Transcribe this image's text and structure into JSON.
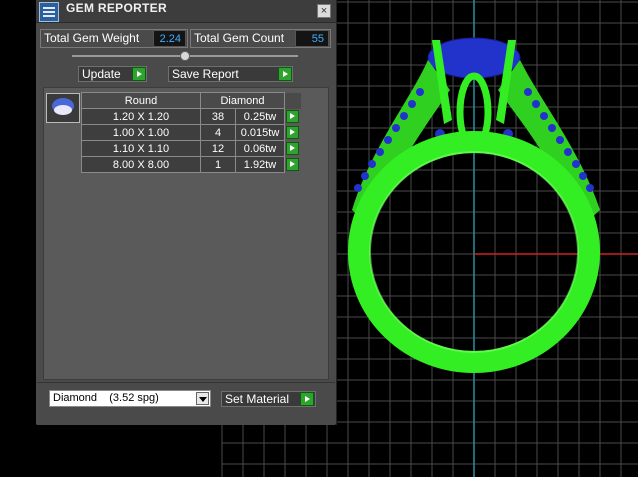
{
  "window": {
    "title": "GEM REPORTER",
    "close_label": "×"
  },
  "summary": {
    "total_weight_label": "Total Gem Weight",
    "total_weight_value": "2.24",
    "total_count_label": "Total Gem Count",
    "total_count_value": "55"
  },
  "toolbar": {
    "update_label": "Update",
    "save_report_label": "Save Report"
  },
  "gem_table": {
    "shape_header": "Round",
    "material_header": "Diamond",
    "rows": [
      {
        "size": "1.20 X 1.20",
        "count": "38",
        "weight": "0.25tw"
      },
      {
        "size": "1.00 X 1.00",
        "count": "4",
        "weight": "0.015tw"
      },
      {
        "size": "1.10 X 1.10",
        "count": "12",
        "weight": "0.06tw"
      },
      {
        "size": "8.00 X 8.00",
        "count": "1",
        "weight": "1.92tw"
      }
    ]
  },
  "material": {
    "selected": "Diamond    (3.52 spg)",
    "set_material_label": "Set Material"
  },
  "colors": {
    "ring": "#33ee22",
    "gem": "#2233cc",
    "axis_x": "#cc2222",
    "axis_y": "#2a8fa0",
    "accent_button": "#2fa32f"
  }
}
